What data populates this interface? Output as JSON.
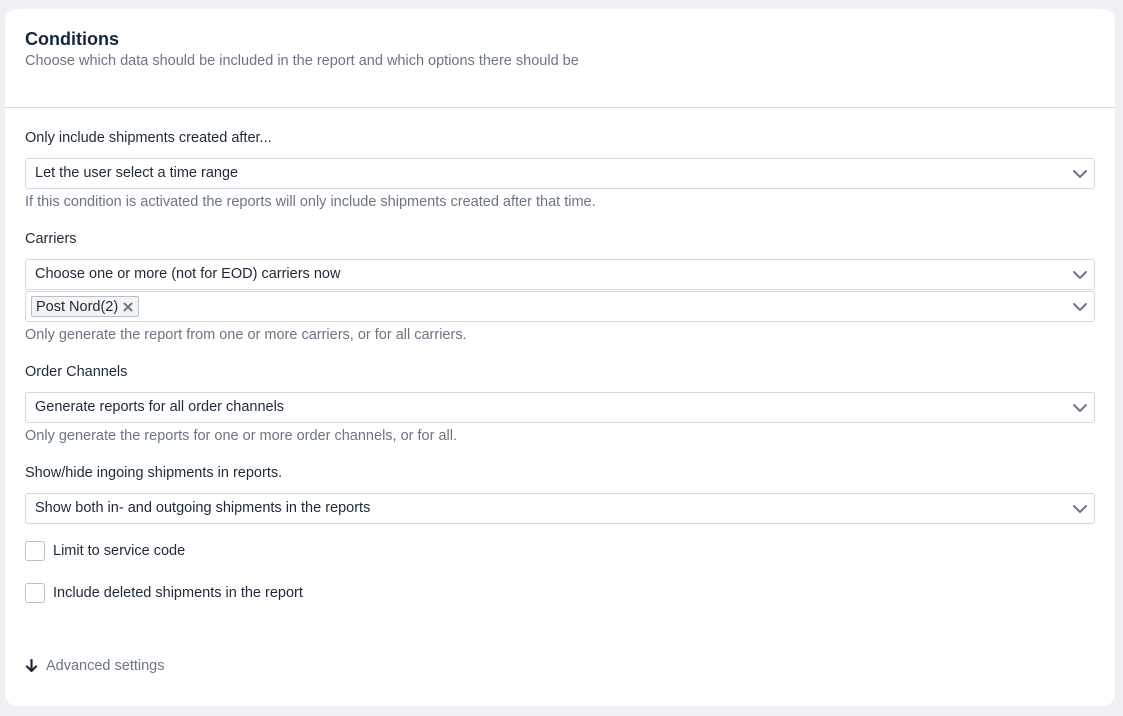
{
  "header": {
    "title": "Conditions",
    "subtitle": "Choose which data should be included in the report and which options there should be"
  },
  "created_after": {
    "label": "Only include shipments created after...",
    "value": "Let the user select a time range",
    "help": "If this condition is activated the reports will only include shipments created after that time."
  },
  "carriers": {
    "label": "Carriers",
    "value": "Choose one or more (not for EOD) carriers now",
    "selected_tags": [
      "Post Nord(2)"
    ],
    "help": "Only generate the report from one or more carriers, or for all carriers."
  },
  "order_channels": {
    "label": "Order Channels",
    "value": "Generate reports for all order channels",
    "help": "Only generate the reports for one or more order channels, or for all."
  },
  "ingoing": {
    "label": "Show/hide ingoing shipments in reports.",
    "value": "Show both in- and outgoing shipments in the reports"
  },
  "checkboxes": {
    "limit_service_code": {
      "label": "Limit to service code",
      "checked": false
    },
    "include_deleted": {
      "label": "Include deleted shipments in the report",
      "checked": false
    }
  },
  "advanced": {
    "label": "Advanced settings",
    "icon": "arrow-down-icon"
  },
  "colors": {
    "title": "#142740",
    "muted": "#6b7585",
    "border": "#d3d8de",
    "background": "#eef0f3"
  }
}
